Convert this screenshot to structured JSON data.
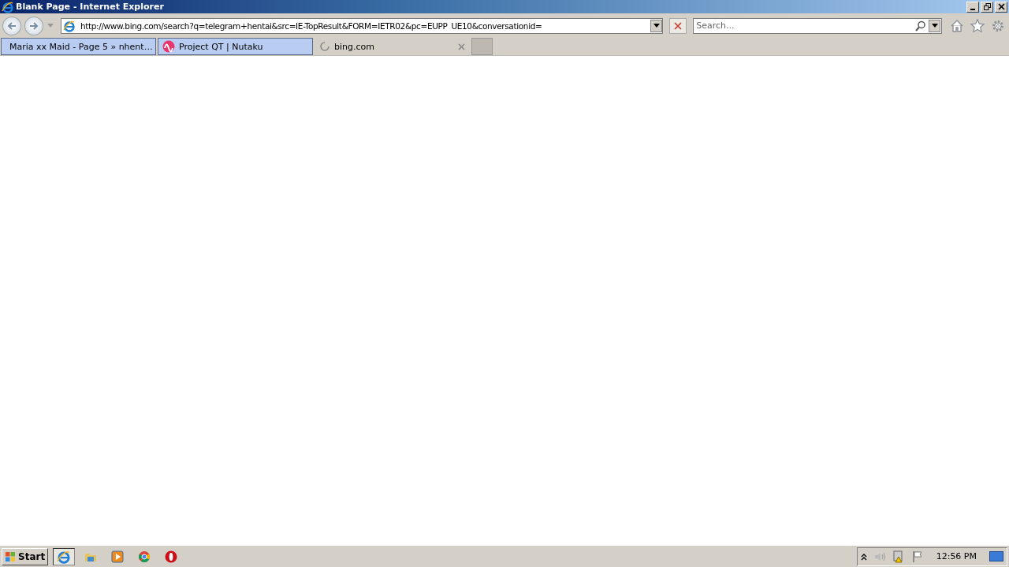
{
  "window": {
    "title": "Blank Page - Internet Explorer"
  },
  "address_bar": {
    "url": "http://www.bing.com/search?q=telegram+hentai&src=IE-TopResult&FORM=IETR02&pc=EUPP_UE10&conversationid="
  },
  "search_field": {
    "placeholder": "Search..."
  },
  "tabs": [
    {
      "title": "Maria xx Maid - Page 5 » nhent…",
      "selected": false,
      "kind": "site"
    },
    {
      "title": "Project QT | Nutaku",
      "selected": false,
      "kind": "wave"
    },
    {
      "title": "bing.com",
      "selected": true,
      "kind": "loading"
    }
  ],
  "taskbar": {
    "start_label": "Start",
    "clock": "12:56 PM"
  }
}
